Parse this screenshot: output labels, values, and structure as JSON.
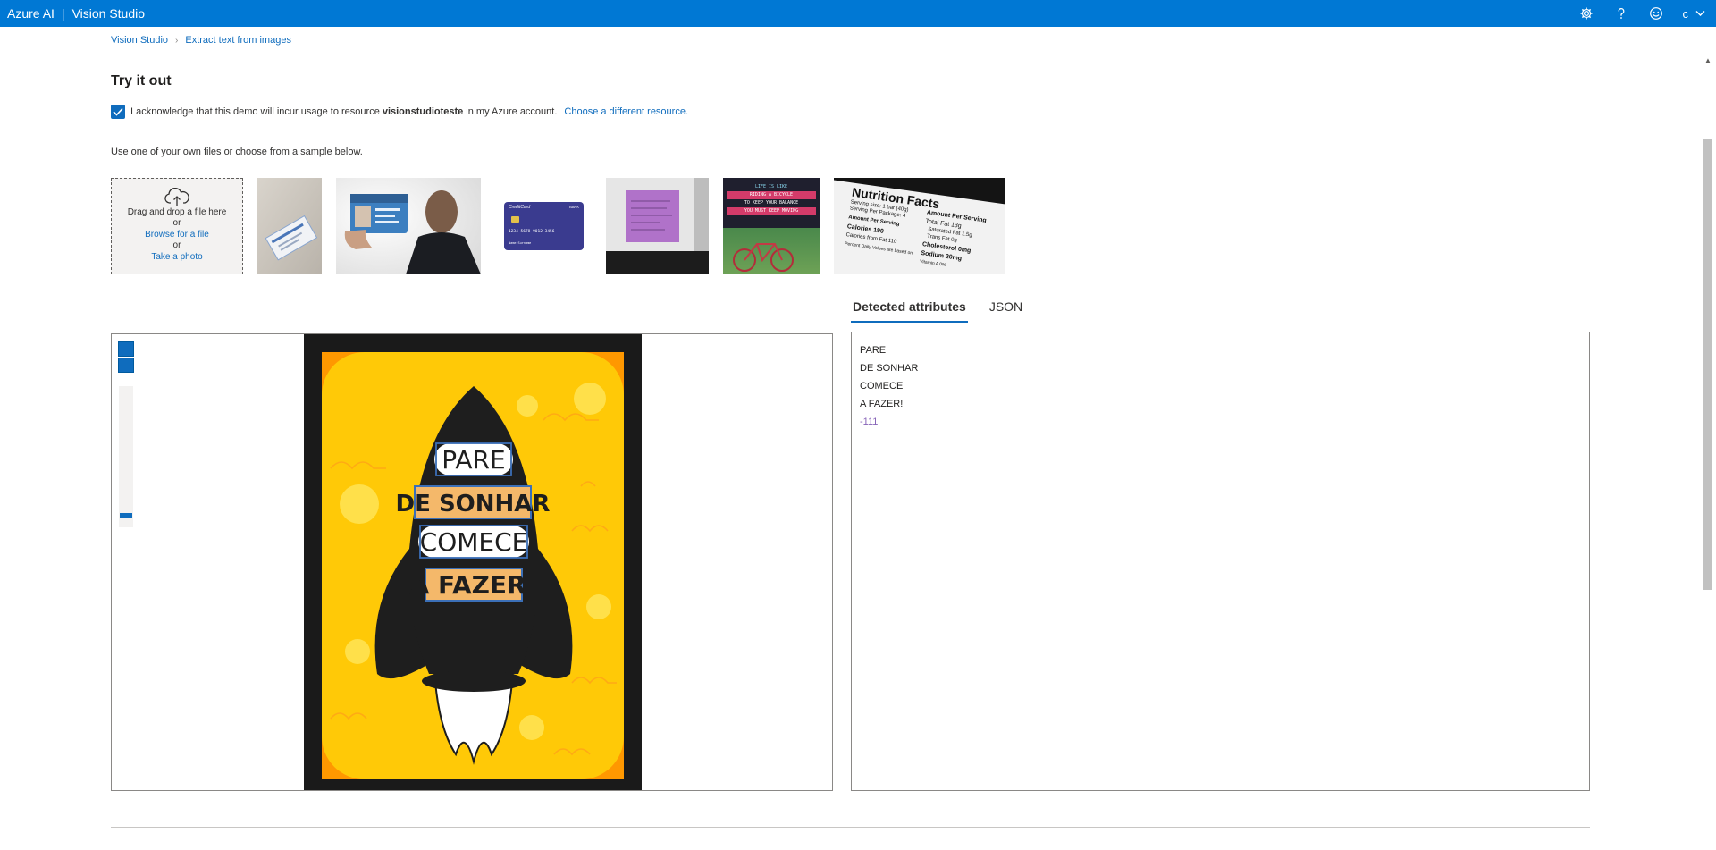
{
  "topbar": {
    "brand_left": "Azure AI",
    "brand_sep": "|",
    "brand_right": "Vision Studio",
    "icons": [
      "gear-icon",
      "help-icon",
      "feedback-smiley-icon"
    ],
    "user_initial": "c"
  },
  "breadcrumb": {
    "home": "Vision Studio",
    "current": "Extract text from images"
  },
  "try_it_out": {
    "heading": "Try it out",
    "ack_prefix": "I acknowledge that this demo will incur usage to resource",
    "resource_name": "visionstudioteste",
    "ack_suffix": "in my Azure account.",
    "change_link": "Choose a different resource.",
    "checked": true
  },
  "samples": {
    "intro": "Use one of your own files or choose from a sample below.",
    "upload": {
      "drag": "Drag and drop a file here",
      "or1": "or",
      "browse": "Browse for a file",
      "or2": "or",
      "photo": "Take a photo"
    },
    "credit_card": {
      "brand": "CreditCard",
      "bank": "BANK",
      "number": "1234 5678 9012 3456",
      "name": "Name Surname"
    },
    "sign": {
      "l1": "LIFE IS LIKE",
      "l2": "RIDING A BICYCLE",
      "l3": "TO KEEP YOUR BALANCE",
      "l4": "YOU MUST KEEP MOVING"
    },
    "nutrition": {
      "title": "Nutrition Facts",
      "serving_size": "Serving size: 1 bar (40g)",
      "servings": "Serving Per Package: 4",
      "amount": "Amount Per Serving",
      "calories": "Calories 190",
      "fat_cal": "Calories from Fat 110",
      "right_head": "Amount Per Serving",
      "total_fat": "Total Fat 13g",
      "sat_fat": "Saturated Fat 1.5g",
      "trans_fat": "Trans Fat 0g",
      "cholesterol": "Cholesterol 0mg",
      "sodium": "Sodium 20mg",
      "daily": "Percent Daily Values are based on",
      "vitamin": "Vitamin A 0%"
    }
  },
  "tabs": [
    {
      "label": "Detected attributes",
      "active": true
    },
    {
      "label": "JSON",
      "active": false
    }
  ],
  "poster": {
    "word1": "PARE",
    "word2": "DE SONHAR",
    "word3": "COMECE",
    "word4": "A FAZER!"
  },
  "results": {
    "lines": [
      "PARE",
      "DE SONHAR",
      "COMECE",
      "A FAZER!"
    ],
    "extra": "-111"
  },
  "colors": {
    "accent": "#0078d4",
    "link": "#0f6cbd",
    "poster_yellow": "#ffc907",
    "poster_orange": "#ff9800",
    "rocket": "#1e1e1e"
  }
}
